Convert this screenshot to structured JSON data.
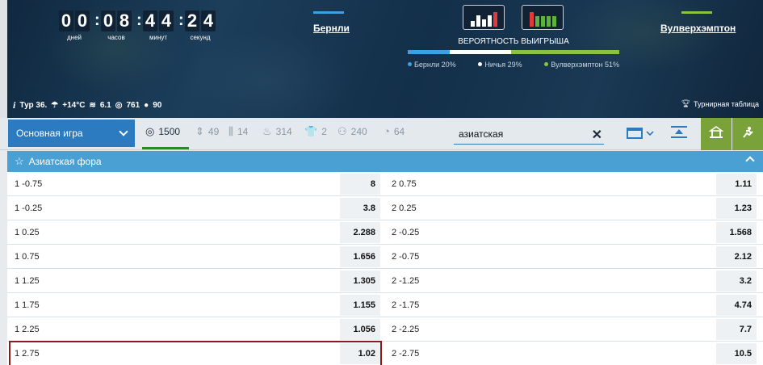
{
  "timer": {
    "units": [
      {
        "digits": [
          "0",
          "0"
        ],
        "label": "дней"
      },
      {
        "digits": [
          "0",
          "8"
        ],
        "label": "часов"
      },
      {
        "digits": [
          "4",
          "4"
        ],
        "label": "минут"
      },
      {
        "digits": [
          "2",
          "4"
        ],
        "label": "секунд"
      }
    ]
  },
  "teams": {
    "home": "Бернли",
    "away": "Вулверхэмптон",
    "home_color": "#3da0e6",
    "away_color": "#8ac43f"
  },
  "form": {
    "home": [
      "mid",
      "high",
      "mid",
      "high",
      "red"
    ],
    "away": [
      "red",
      "green",
      "green",
      "green",
      "green"
    ]
  },
  "probability": {
    "title": "ВЕРОЯТНОСТЬ ВЫИГРЫША",
    "home_pct": 20,
    "draw_pct": 29,
    "away_pct": 51,
    "legend": [
      "Бернли 20%",
      "Ничья 29%",
      "Вулверхэмптон 51%"
    ],
    "colors": [
      "#3da0e6",
      "#ffffff",
      "#8ac43f"
    ]
  },
  "info": {
    "round": "Тур 36.",
    "temp": "+14°C",
    "wind": "6.1",
    "pressure": "761",
    "humidity": "90",
    "standings": "Турнирная таблица"
  },
  "toolbar": {
    "game_select": "Основная игра",
    "markets": [
      {
        "icon": "target-icon",
        "glyph": "◎",
        "count": "1500"
      },
      {
        "icon": "updown-icon",
        "glyph": "⇕",
        "count": "49"
      },
      {
        "icon": "stats-icon",
        "glyph": "⫼",
        "count": "14"
      },
      {
        "icon": "fire-icon",
        "glyph": "♨",
        "count": "314"
      },
      {
        "icon": "shirt-icon",
        "glyph": "👕",
        "count": "2"
      },
      {
        "icon": "players-icon",
        "glyph": "⚇",
        "count": "240"
      },
      {
        "icon": "timer-icon",
        "glyph": "◔",
        "count": "64"
      }
    ],
    "search_value": "азиатская"
  },
  "section": {
    "title": "Азиатская фора",
    "rows": [
      {
        "left": "1 -0.75",
        "left_odd": "8",
        "right": "2 0.75",
        "right_odd": "1.11"
      },
      {
        "left": "1 -0.25",
        "left_odd": "3.8",
        "right": "2 0.25",
        "right_odd": "1.23"
      },
      {
        "left": "1 0.25",
        "left_odd": "2.288",
        "right": "2 -0.25",
        "right_odd": "1.568"
      },
      {
        "left": "1 0.75",
        "left_odd": "1.656",
        "right": "2 -0.75",
        "right_odd": "2.12"
      },
      {
        "left": "1 1.25",
        "left_odd": "1.305",
        "right": "2 -1.25",
        "right_odd": "3.2"
      },
      {
        "left": "1 1.75",
        "left_odd": "1.155",
        "right": "2 -1.75",
        "right_odd": "4.74"
      },
      {
        "left": "1 2.25",
        "left_odd": "1.056",
        "right": "2 -2.25",
        "right_odd": "7.7"
      },
      {
        "left": "1 2.75",
        "left_odd": "1.02",
        "right": "2 -2.75",
        "right_odd": "10.5"
      }
    ]
  }
}
